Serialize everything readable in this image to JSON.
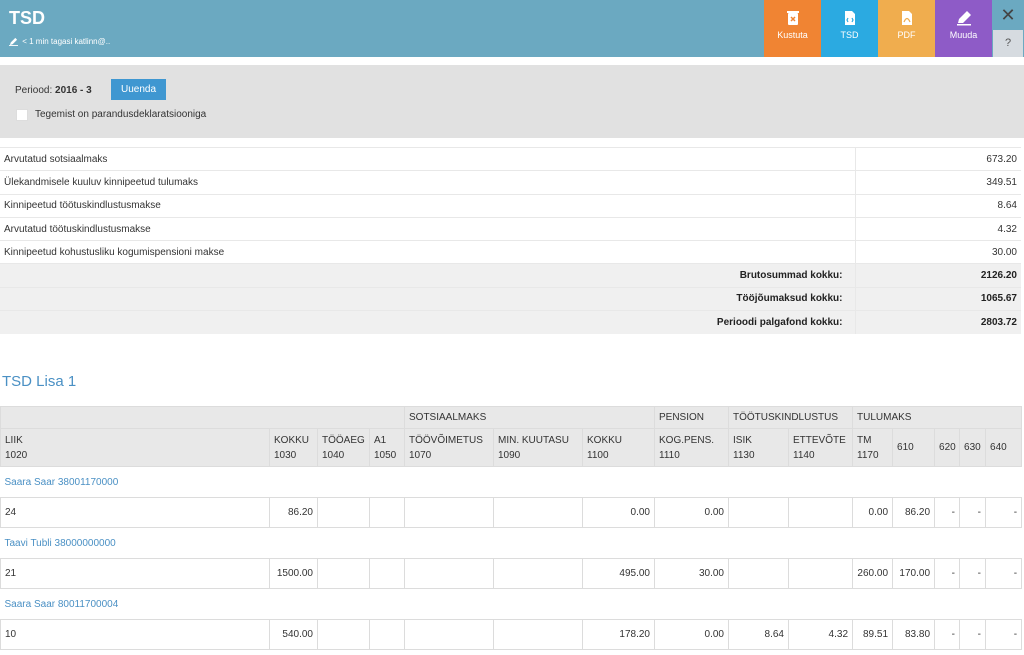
{
  "header": {
    "title": "TSD",
    "subtitle": "< 1 min tagasi katlinn@..",
    "buttons": [
      {
        "label": "Kustuta",
        "color": "#f08433",
        "icon": "trash-icon"
      },
      {
        "label": "TSD",
        "color": "#2baae1",
        "icon": "file-code-icon"
      },
      {
        "label": "PDF",
        "color": "#f0ad4e",
        "icon": "pdf-icon"
      },
      {
        "label": "Muuda",
        "color": "#8e5bc7",
        "icon": "pencil-icon"
      }
    ],
    "close_glyph": "✕",
    "help_glyph": "?"
  },
  "filter": {
    "period_label": "Periood:",
    "period_value": "2016 - 3",
    "update_button": "Uuenda",
    "correction_label": "Tegemist on parandusdeklaratsiooniga"
  },
  "summary": {
    "rows": [
      {
        "label": "Arvutatud sotsiaalmaks",
        "value": "673.20"
      },
      {
        "label": "Ülekandmisele kuuluv kinnipeetud tulumaks",
        "value": "349.51"
      },
      {
        "label": "Kinnipeetud töötuskindlustusmakse",
        "value": "8.64"
      },
      {
        "label": "Arvutatud töötuskindlustusmakse",
        "value": "4.32"
      },
      {
        "label": "Kinnipeetud kohustusliku kogumispensioni makse",
        "value": "30.00"
      }
    ],
    "totals": [
      {
        "label": "Brutosummad kokku:",
        "value": "2126.20"
      },
      {
        "label": "Tööjõumaksud kokku:",
        "value": "1065.67"
      },
      {
        "label": "Perioodi palgafond kokku:",
        "value": "2803.72"
      }
    ]
  },
  "lisa": {
    "title": "TSD Lisa 1",
    "groups": [
      "SOTSIAALMAKS",
      "PENSION",
      "TÖÖTUSKINDLUSTUS",
      "TULUMAKS"
    ],
    "columns": [
      {
        "name": "LIIK",
        "code": "1020"
      },
      {
        "name": "KOKKU",
        "code": "1030"
      },
      {
        "name": "TÖÖAEG",
        "code": "1040"
      },
      {
        "name": "A1",
        "code": "1050"
      },
      {
        "name": "TÖÖVÕIMETUS",
        "code": "1070"
      },
      {
        "name": "MIN. KUUTASU",
        "code": "1090"
      },
      {
        "name": "KOKKU",
        "code": "1100"
      },
      {
        "name": "KOG.PENS.",
        "code": "1110"
      },
      {
        "name": "ISIK",
        "code": "1130"
      },
      {
        "name": "ETTEVÕTE",
        "code": "1140"
      },
      {
        "name": "TM",
        "code": "1170"
      },
      {
        "name": "610",
        "code": ""
      },
      {
        "name": "620",
        "code": ""
      },
      {
        "name": "630",
        "code": ""
      },
      {
        "name": "640",
        "code": ""
      }
    ],
    "persons": [
      {
        "name": "Saara Saar 38001170000",
        "cells": [
          "24",
          "86.20",
          "",
          "",
          "",
          "",
          "0.00",
          "0.00",
          "",
          "",
          "0.00",
          "86.20",
          "-",
          "-",
          "-"
        ]
      },
      {
        "name": "Taavi Tubli 38000000000",
        "cells": [
          "21",
          "1500.00",
          "",
          "",
          "",
          "",
          "495.00",
          "30.00",
          "",
          "",
          "260.00",
          "170.00",
          "-",
          "-",
          "-"
        ]
      },
      {
        "name": "Saara Saar 80011700004",
        "cells": [
          "10",
          "540.00",
          "",
          "",
          "",
          "",
          "178.20",
          "0.00",
          "8.64",
          "4.32",
          "89.51",
          "83.80",
          "-",
          "-",
          "-"
        ]
      }
    ]
  }
}
